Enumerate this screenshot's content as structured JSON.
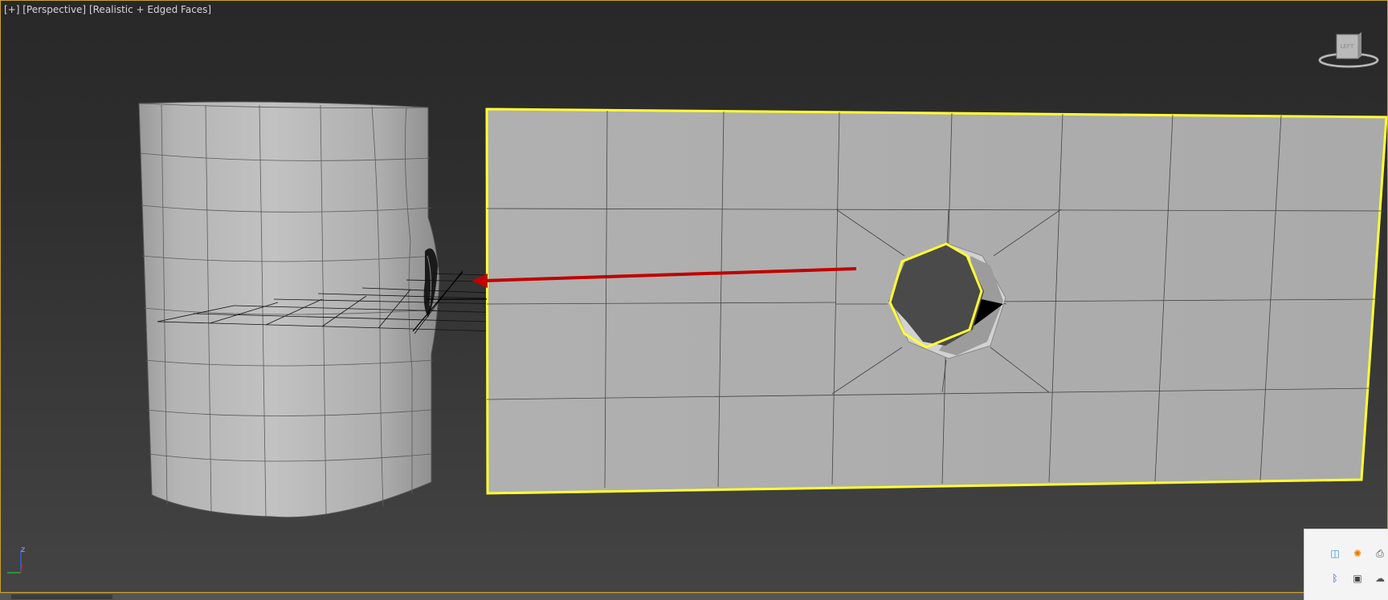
{
  "viewport": {
    "label_parts": [
      "[+]",
      "[Perspective]",
      "[Realistic + Edged Faces]"
    ],
    "viewcube_face": "LEFT",
    "accent_border_color": "#c9a227",
    "selection_color": "#ffff33",
    "arrow_color": "#c00000"
  },
  "axis_tripod": {
    "z_label": "z"
  },
  "tray": {
    "icons": [
      {
        "name": "app-icon",
        "glyph": "◫",
        "color": "#2a8fd8"
      },
      {
        "name": "avast-icon",
        "glyph": "✺",
        "color": "#f07800"
      },
      {
        "name": "printer-icon",
        "glyph": "⎙",
        "color": "#444444"
      },
      {
        "name": "bluetooth-icon",
        "glyph": "ᛒ",
        "color": "#1b5fb5"
      },
      {
        "name": "device-icon",
        "glyph": "▣",
        "color": "#444444"
      },
      {
        "name": "cloud-icon",
        "glyph": "☁",
        "color": "#555555"
      }
    ]
  }
}
